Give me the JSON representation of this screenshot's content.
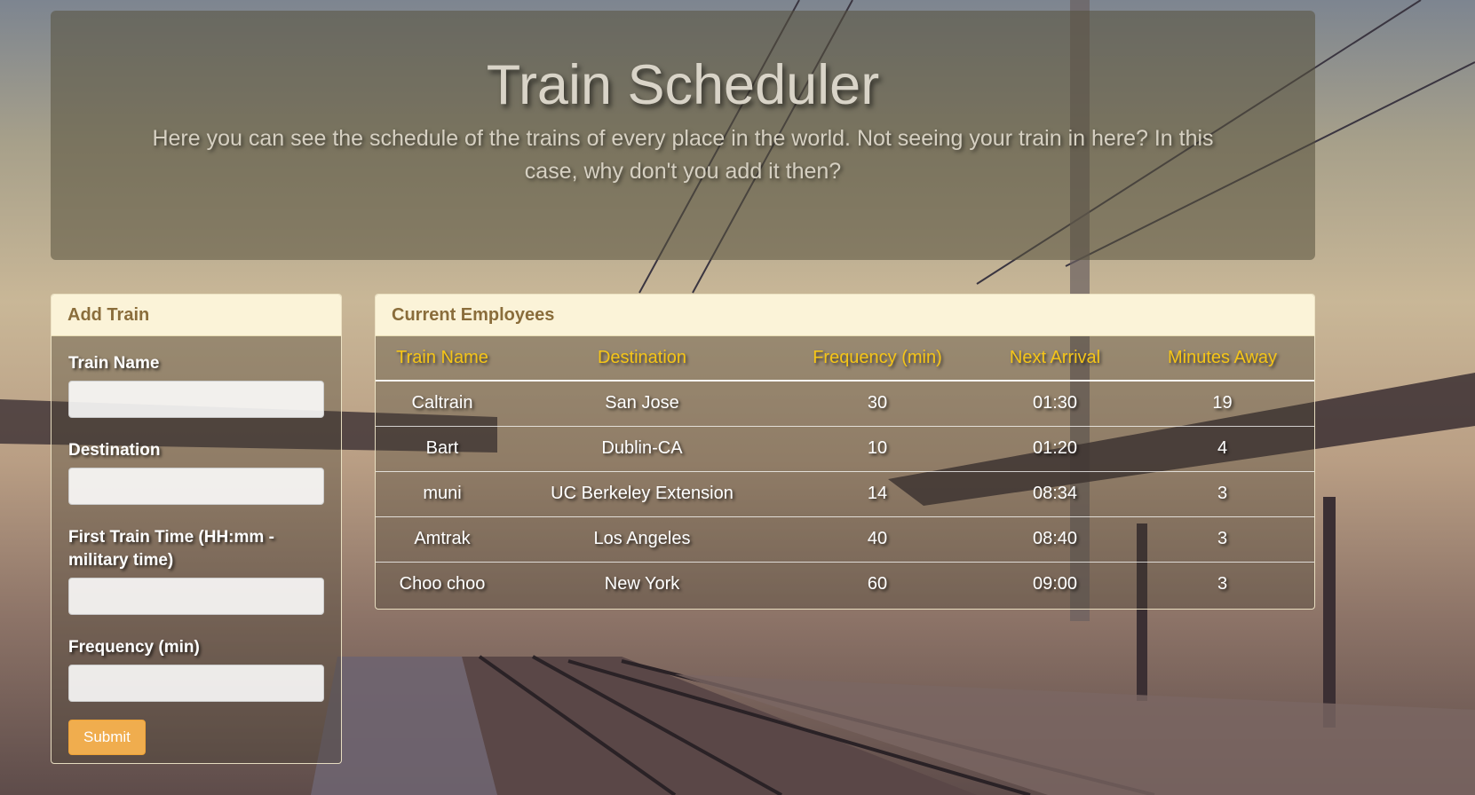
{
  "jumbotron": {
    "title": "Train Scheduler",
    "subtitle": "Here you can see the schedule of the trains of every place in the world. Not seeing your train in here? In this case, why don't you add it then?"
  },
  "add_train": {
    "heading": "Add Train",
    "fields": {
      "train_name": {
        "label": "Train Name",
        "value": ""
      },
      "destination": {
        "label": "Destination",
        "value": ""
      },
      "first_time": {
        "label": "First Train Time (HH:mm - military time)",
        "value": ""
      },
      "frequency": {
        "label": "Frequency (min)",
        "value": ""
      }
    },
    "submit_label": "Submit"
  },
  "schedule": {
    "heading": "Current Employees",
    "columns": [
      "Train Name",
      "Destination",
      "Frequency (min)",
      "Next Arrival",
      "Minutes Away"
    ],
    "rows": [
      [
        "Caltrain",
        "San Jose",
        "30",
        "01:30",
        "19"
      ],
      [
        "Bart",
        "Dublin-CA",
        "10",
        "01:20",
        "4"
      ],
      [
        "muni",
        "UC Berkeley Extension",
        "14",
        "08:34",
        "3"
      ],
      [
        "Amtrak",
        "Los Angeles",
        "40",
        "08:40",
        "3"
      ],
      [
        "Choo choo",
        "New York",
        "60",
        "09:00",
        "3"
      ]
    ]
  },
  "colors": {
    "header_text": "#f5c518",
    "panel_heading_text": "#8a6d3b",
    "button": "#f0ad4e"
  }
}
